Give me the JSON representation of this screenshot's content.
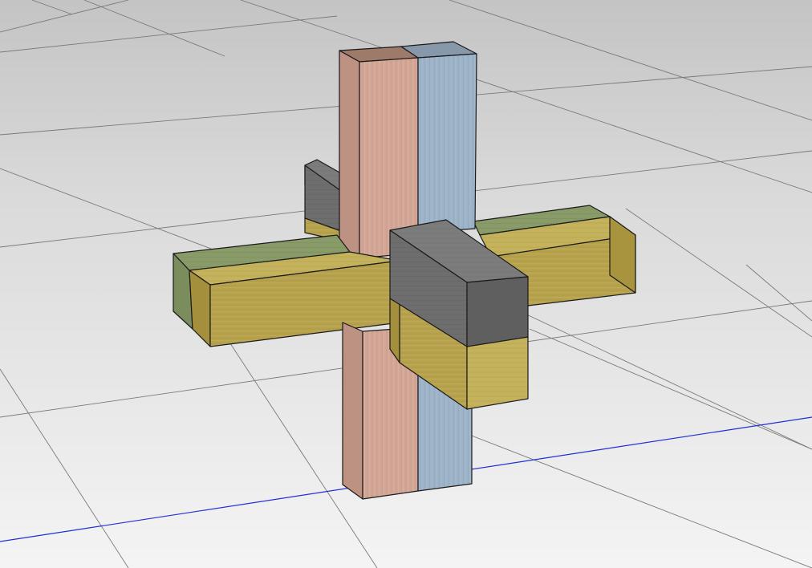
{
  "viewport": {
    "name": "3d-viewport",
    "background_top": "#c9c9c9",
    "background_bottom": "#f2f2f2",
    "grid_color": "#7a7a7a",
    "axis_color": "#1f2fd6"
  },
  "model": {
    "name": "six-piece-burr-puzzle",
    "pieces": [
      {
        "id": "vertical-piece-pink",
        "color": "#d4a898"
      },
      {
        "id": "vertical-piece-blue",
        "color": "#9fb4c8"
      },
      {
        "id": "horizontal-piece-green",
        "color": "#8a9c6a"
      },
      {
        "id": "horizontal-piece-yellow-left",
        "color": "#b8a450"
      },
      {
        "id": "horizontal-piece-gray",
        "color": "#6f6f6f"
      },
      {
        "id": "horizontal-piece-yellow-front",
        "color": "#b8a450"
      }
    ]
  }
}
